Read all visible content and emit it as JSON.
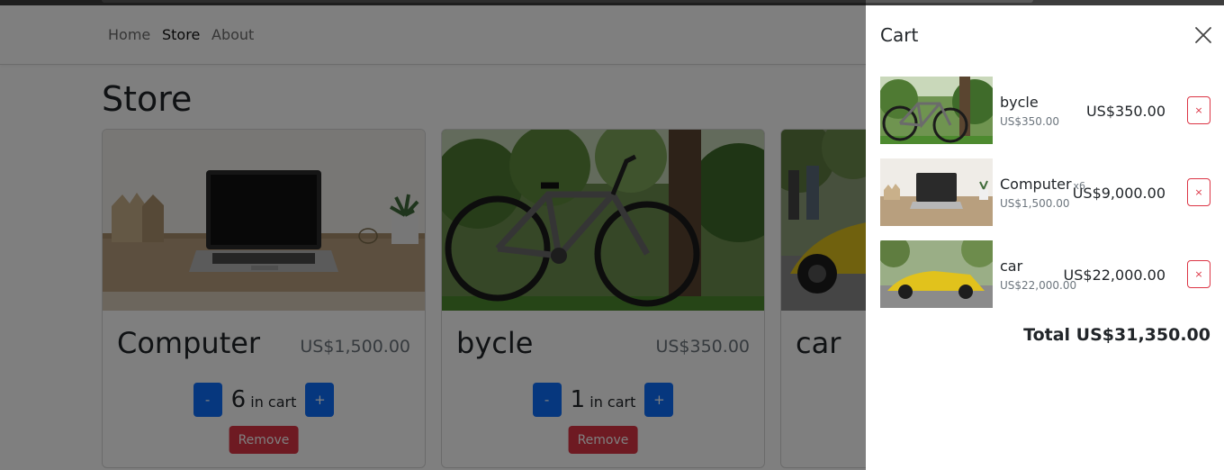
{
  "nav": {
    "home": "Home",
    "store": "Store",
    "about": "About"
  },
  "page_title": "Store",
  "products": [
    {
      "name": "Computer",
      "price": "US$1,500.00",
      "quantity": "6",
      "in_cart_suffix": "in cart",
      "minus": "-",
      "plus": "+",
      "remove": "Remove"
    },
    {
      "name": "bycle",
      "price": "US$350.00",
      "quantity": "1",
      "in_cart_suffix": "in cart",
      "minus": "-",
      "plus": "+",
      "remove": "Remove"
    },
    {
      "name": "car"
    }
  ],
  "cart": {
    "title": "Cart",
    "items": [
      {
        "name": "bycle",
        "qty_label": "",
        "unit_price": "US$350.00",
        "line_total": "US$350.00",
        "remove": "×"
      },
      {
        "name": "Computer",
        "qty_label": "x6",
        "unit_price": "US$1,500.00",
        "line_total": "US$9,000.00",
        "remove": "×"
      },
      {
        "name": "car",
        "qty_label": "",
        "unit_price": "US$22,000.00",
        "line_total": "US$22,000.00",
        "remove": "×"
      }
    ],
    "total": "Total US$31,350.00"
  },
  "colors": {
    "primary": "#0d6efd",
    "danger": "#dc3545",
    "backdrop": "#000000"
  },
  "icons": {
    "close": "close-icon"
  }
}
